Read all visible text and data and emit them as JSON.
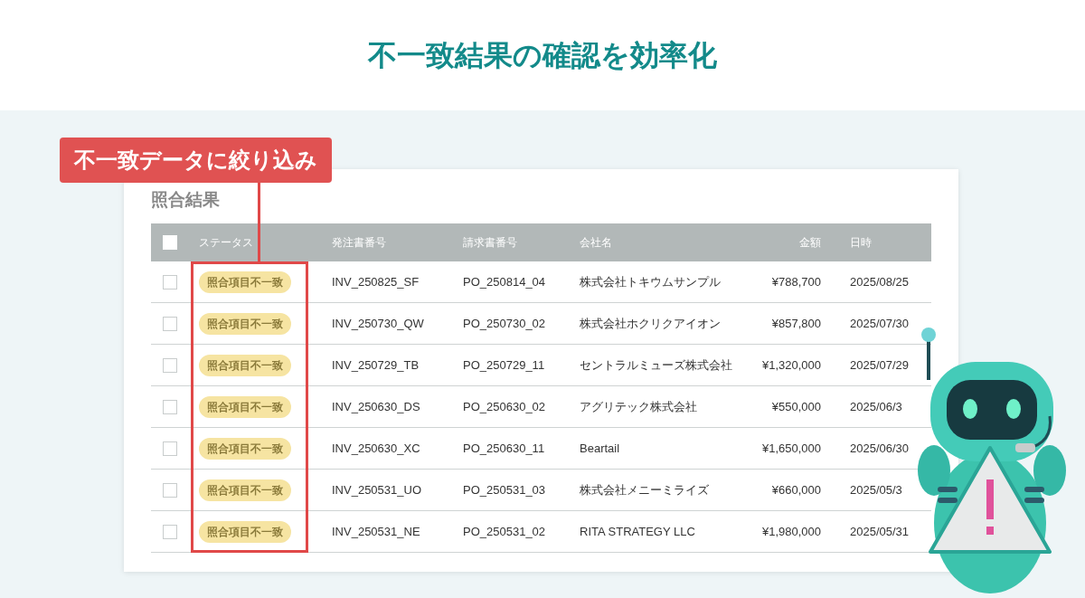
{
  "headline": "不一致結果の確認を効率化",
  "callout": {
    "label": "不一致データに絞り込み"
  },
  "panel": {
    "title": "照合結果",
    "select_all": {
      "checked": false
    },
    "columns": [
      "ステータス",
      "発注書番号",
      "請求書番号",
      "会社名",
      "金額",
      "日時"
    ],
    "rows": [
      {
        "checked": false,
        "status": "照合項目不一致",
        "order_no": "INV_250825_SF",
        "invoice_no": "PO_250814_04",
        "company": "株式会社トキウムサンプル",
        "amount": "¥788,700",
        "date": "2025/08/25"
      },
      {
        "checked": false,
        "status": "照合項目不一致",
        "order_no": "INV_250730_QW",
        "invoice_no": "PO_250730_02",
        "company": "株式会社ホクリクアイオン",
        "amount": "¥857,800",
        "date": "2025/07/30"
      },
      {
        "checked": false,
        "status": "照合項目不一致",
        "order_no": "INV_250729_TB",
        "invoice_no": "PO_250729_11",
        "company": "セントラルミューズ株式会社",
        "amount": "¥1,320,000",
        "date": "2025/07/29"
      },
      {
        "checked": false,
        "status": "照合項目不一致",
        "order_no": "INV_250630_DS",
        "invoice_no": "PO_250630_02",
        "company": "アグリテック株式会社",
        "amount": "¥550,000",
        "date": "2025/06/3"
      },
      {
        "checked": false,
        "status": "照合項目不一致",
        "order_no": "INV_250630_XC",
        "invoice_no": "PO_250630_11",
        "company": "Beartail",
        "amount": "¥1,650,000",
        "date": "2025/06/30"
      },
      {
        "checked": false,
        "status": "照合項目不一致",
        "order_no": "INV_250531_UO",
        "invoice_no": "PO_250531_03",
        "company": "株式会社メニーミライズ",
        "amount": "¥660,000",
        "date": "2025/05/3"
      },
      {
        "checked": false,
        "status": "照合項目不一致",
        "order_no": "INV_250531_NE",
        "invoice_no": "PO_250531_02",
        "company": "RITA STRATEGY LLC",
        "amount": "¥1,980,000",
        "date": "2025/05/31"
      }
    ]
  }
}
